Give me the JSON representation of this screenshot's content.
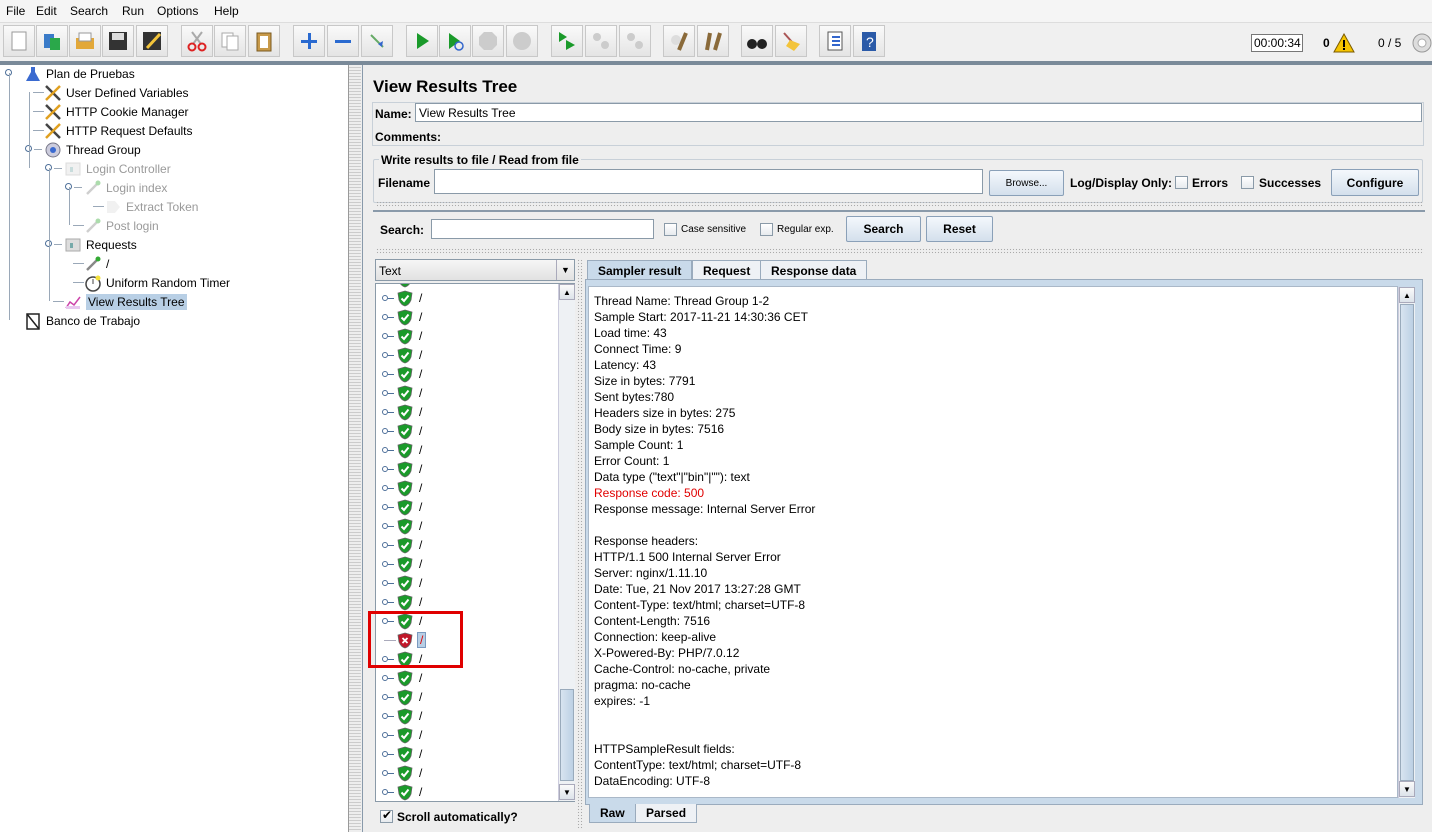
{
  "menu": [
    "File",
    "Edit",
    "Search",
    "Run",
    "Options",
    "Help"
  ],
  "toolbar": {
    "buttons": [
      "new-icon",
      "templates-icon",
      "open-icon",
      "save-icon",
      "save-as-icon",
      "cut-icon",
      "copy-icon",
      "paste-icon",
      "expand-icon",
      "collapse-icon",
      "toggle-icon",
      "start-icon",
      "start-no-pause-icon",
      "stop-icon",
      "shutdown-icon",
      "remote-start-all-icon",
      "remote-stop-all-icon",
      "remote-shutdown-all-icon",
      "clear-icon",
      "clear-all-icon",
      "search-icon",
      "reset-search-icon",
      "function-helper-icon",
      "help-icon"
    ],
    "timer": "00:00:34",
    "warnings": "0",
    "threads": "0 / 5"
  },
  "tree": {
    "items": [
      {
        "label": "Plan de Pruebas",
        "icon": "flask-icon"
      },
      {
        "label": "User Defined Variables",
        "icon": "tools-icon"
      },
      {
        "label": "HTTP Cookie Manager",
        "icon": "tools-icon"
      },
      {
        "label": "HTTP Request Defaults",
        "icon": "tools-icon"
      },
      {
        "label": "Thread Group",
        "icon": "gear-icon"
      },
      {
        "label": "Login Controller",
        "icon": "controller-icon",
        "disabled": true
      },
      {
        "label": "Login index",
        "icon": "pipette-icon",
        "disabled": true
      },
      {
        "label": "Extract Token",
        "icon": "extractor-icon",
        "disabled": true
      },
      {
        "label": "Post login",
        "icon": "pipette-icon",
        "disabled": true
      },
      {
        "label": "Requests",
        "icon": "controller-icon"
      },
      {
        "label": "/",
        "icon": "pipette-icon"
      },
      {
        "label": "Uniform Random Timer",
        "icon": "timer-icon"
      },
      {
        "label": "View Results Tree",
        "icon": "chart-icon",
        "selected": true
      },
      {
        "label": "Banco de Trabajo",
        "icon": "workbench-icon"
      }
    ]
  },
  "panel": {
    "title": "View Results Tree",
    "name_label": "Name:",
    "name_value": "View Results Tree",
    "comments_label": "Comments:",
    "file_group": "Write results to file / Read from file",
    "filename_label": "Filename",
    "filename_value": "",
    "browse": "Browse...",
    "log_display": "Log/Display Only:",
    "errors": "Errors",
    "successes": "Successes",
    "configure": "Configure",
    "search_label": "Search:",
    "search_value": "",
    "case_sensitive": "Case sensitive",
    "regular_exp": "Regular exp.",
    "search_btn": "Search",
    "reset_btn": "Reset",
    "renderer": "Text",
    "scroll_auto": "Scroll automatically?",
    "scroll_auto_checked": true
  },
  "results": {
    "rows": [
      "/",
      "/",
      "/",
      "/",
      "/",
      "/",
      "/",
      "/",
      "/",
      "/",
      "/",
      "/",
      "/",
      "/",
      "/",
      "/",
      "/",
      "/",
      "/",
      "/",
      "/",
      "/",
      "/",
      "/",
      "/",
      "/",
      "/"
    ],
    "error_index": 18,
    "status_colors": {
      "success": "#1a9a2a",
      "error": "#c0182a"
    },
    "highlight_color": "#e00000"
  },
  "tabs": [
    "Sampler result",
    "Request",
    "Response data"
  ],
  "bottom_tabs": [
    "Raw",
    "Parsed"
  ],
  "sampler": {
    "lines": [
      "Thread Name: Thread Group 1-2",
      "Sample Start: 2017-11-21 14:30:36 CET",
      "Load time: 43",
      "Connect Time: 9",
      "Latency: 43",
      "Size in bytes: 7791",
      "Sent bytes:780",
      "Headers size in bytes: 275",
      "Body size in bytes: 7516",
      "Sample Count: 1",
      "Error Count: 1",
      "Data type (\"text\"|\"bin\"|\"\"): text"
    ],
    "response_code": "Response code: 500",
    "response_code_color": "#e00000",
    "lines2": [
      "Response message: Internal Server Error",
      "",
      "Response headers:",
      "HTTP/1.1 500 Internal Server Error",
      "Server: nginx/1.11.10",
      "Date: Tue, 21 Nov 2017 13:27:28 GMT",
      "Content-Type: text/html; charset=UTF-8",
      "Content-Length: 7516",
      "Connection: keep-alive",
      "X-Powered-By: PHP/7.0.12",
      "Cache-Control: no-cache, private",
      "pragma: no-cache",
      "expires: -1",
      "",
      "",
      "HTTPSampleResult fields:",
      "ContentType: text/html; charset=UTF-8",
      "DataEncoding: UTF-8"
    ]
  }
}
